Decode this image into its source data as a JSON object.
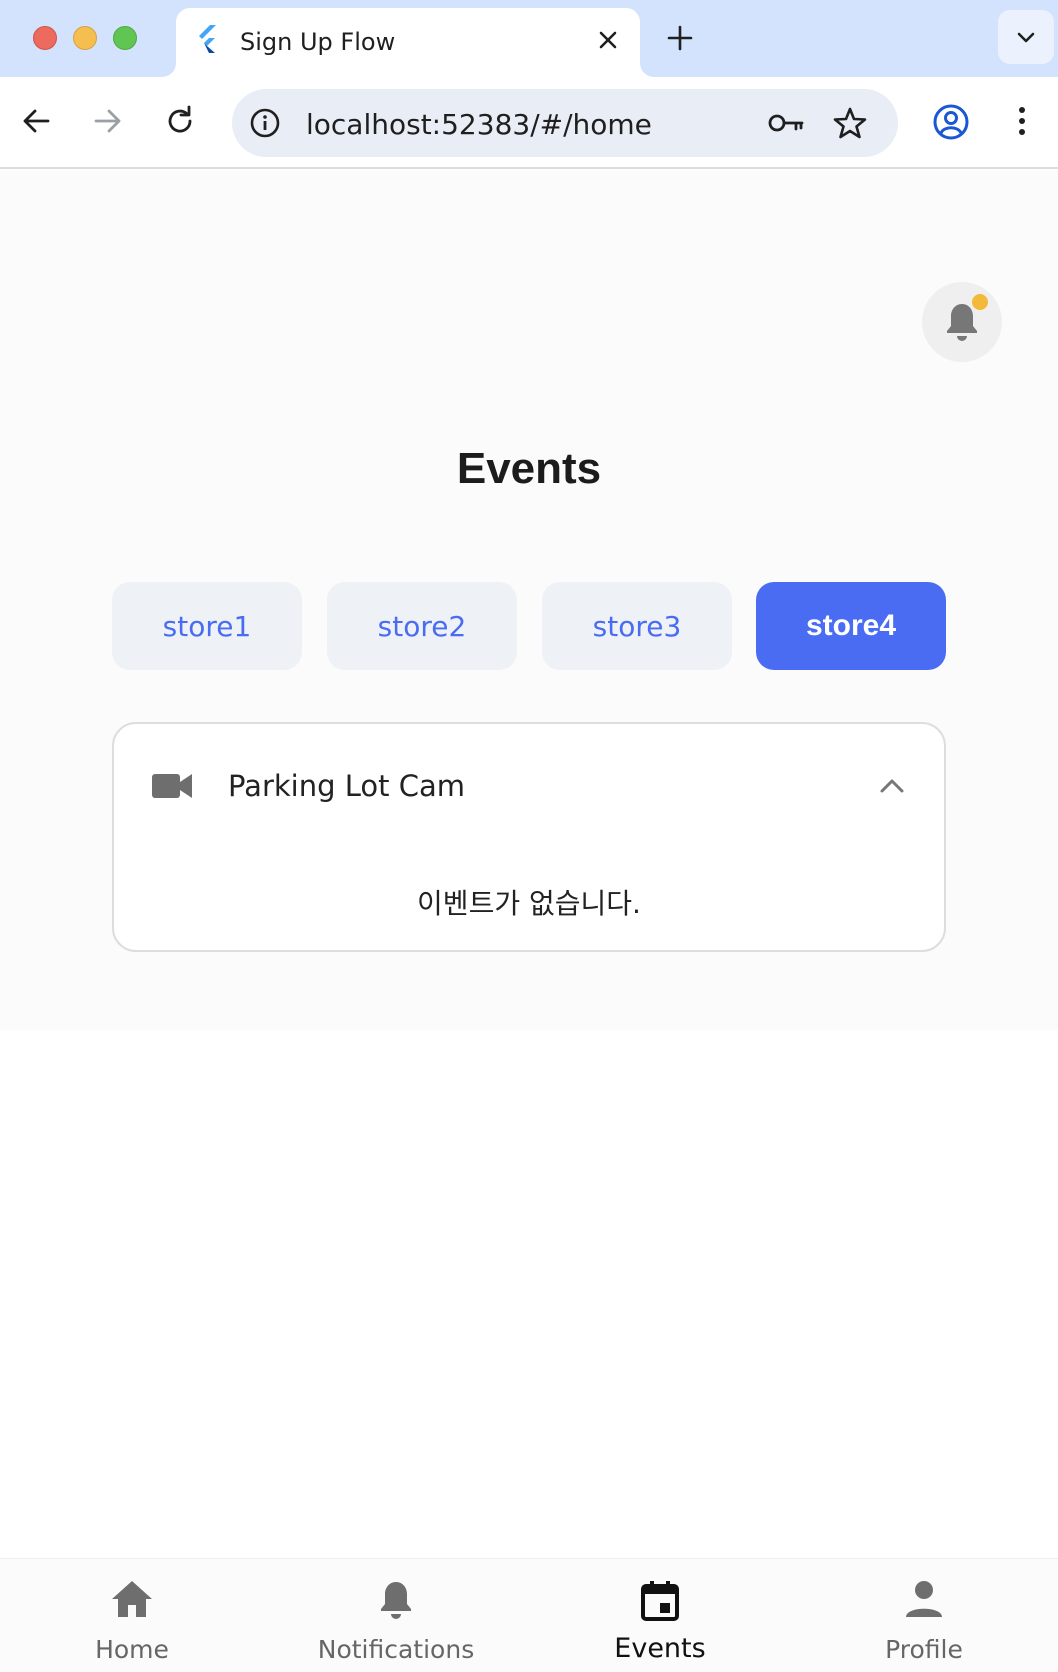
{
  "browser": {
    "tab_title": "Sign Up Flow",
    "url": "localhost:52383/#/home"
  },
  "page": {
    "title": "Events",
    "has_unread_notification": true
  },
  "stores": [
    {
      "label": "store1",
      "selected": false
    },
    {
      "label": "store2",
      "selected": false
    },
    {
      "label": "store3",
      "selected": false
    },
    {
      "label": "store4",
      "selected": true
    }
  ],
  "camera": {
    "name": "Parking Lot Cam",
    "expanded": true,
    "empty_message": "이벤트가 없습니다."
  },
  "bottom_nav": [
    {
      "label": "Home",
      "icon": "home-icon",
      "active": false
    },
    {
      "label": "Notifications",
      "icon": "bell-icon",
      "active": false
    },
    {
      "label": "Events",
      "icon": "calendar-event-icon",
      "active": true
    },
    {
      "label": "Profile",
      "icon": "person-icon",
      "active": false
    }
  ],
  "colors": {
    "accent": "#4a6cf2",
    "store_inactive_bg": "#eef1f5",
    "notification_dot": "#f3b93a",
    "chrome_tabstrip": "#d3e3fd"
  }
}
